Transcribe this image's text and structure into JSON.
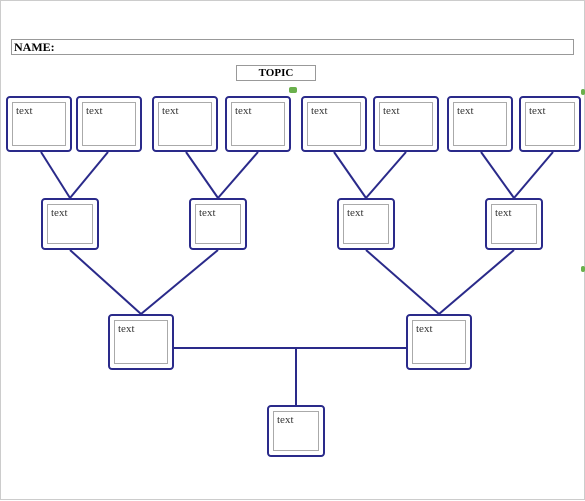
{
  "name_label": "NAME:",
  "topic_label": "TOPIC",
  "placeholder": "text",
  "nodes": {
    "r1": [
      "text",
      "text",
      "text",
      "text",
      "text",
      "text",
      "text",
      "text"
    ],
    "r2": [
      "text",
      "text",
      "text",
      "text"
    ],
    "r3": [
      "text",
      "text"
    ],
    "r4": [
      "text"
    ]
  }
}
